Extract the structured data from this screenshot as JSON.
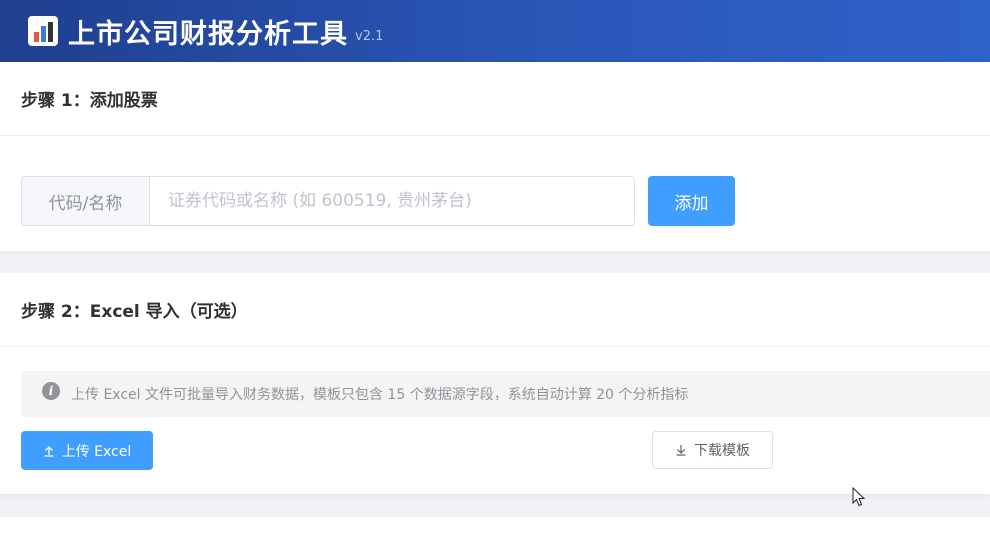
{
  "header": {
    "title": "上市公司财报分析工具",
    "version": "v2.1",
    "logo_icon": "bar-chart-icon"
  },
  "step1": {
    "title": "步骤 1：添加股票",
    "prepend_label": "代码/名称",
    "input_placeholder": "证券代码或名称 (如 600519, 贵州茅台)",
    "input_value": "",
    "add_label": "添加"
  },
  "step2": {
    "title": "步骤 2：Excel 导入（可选）",
    "info_icon": "info-icon",
    "info_text": "上传 Excel 文件可批量导入财务数据，模板只包含 15 个数据源字段，系统自动计算 20 个分析指标",
    "upload_label": "上传 Excel",
    "upload_icon": "upload-icon",
    "download_label": "下载模板",
    "download_icon": "download-icon"
  },
  "colors": {
    "primary": "#409eff",
    "header_start": "#1f3f8f",
    "header_end": "#2f62c9"
  }
}
